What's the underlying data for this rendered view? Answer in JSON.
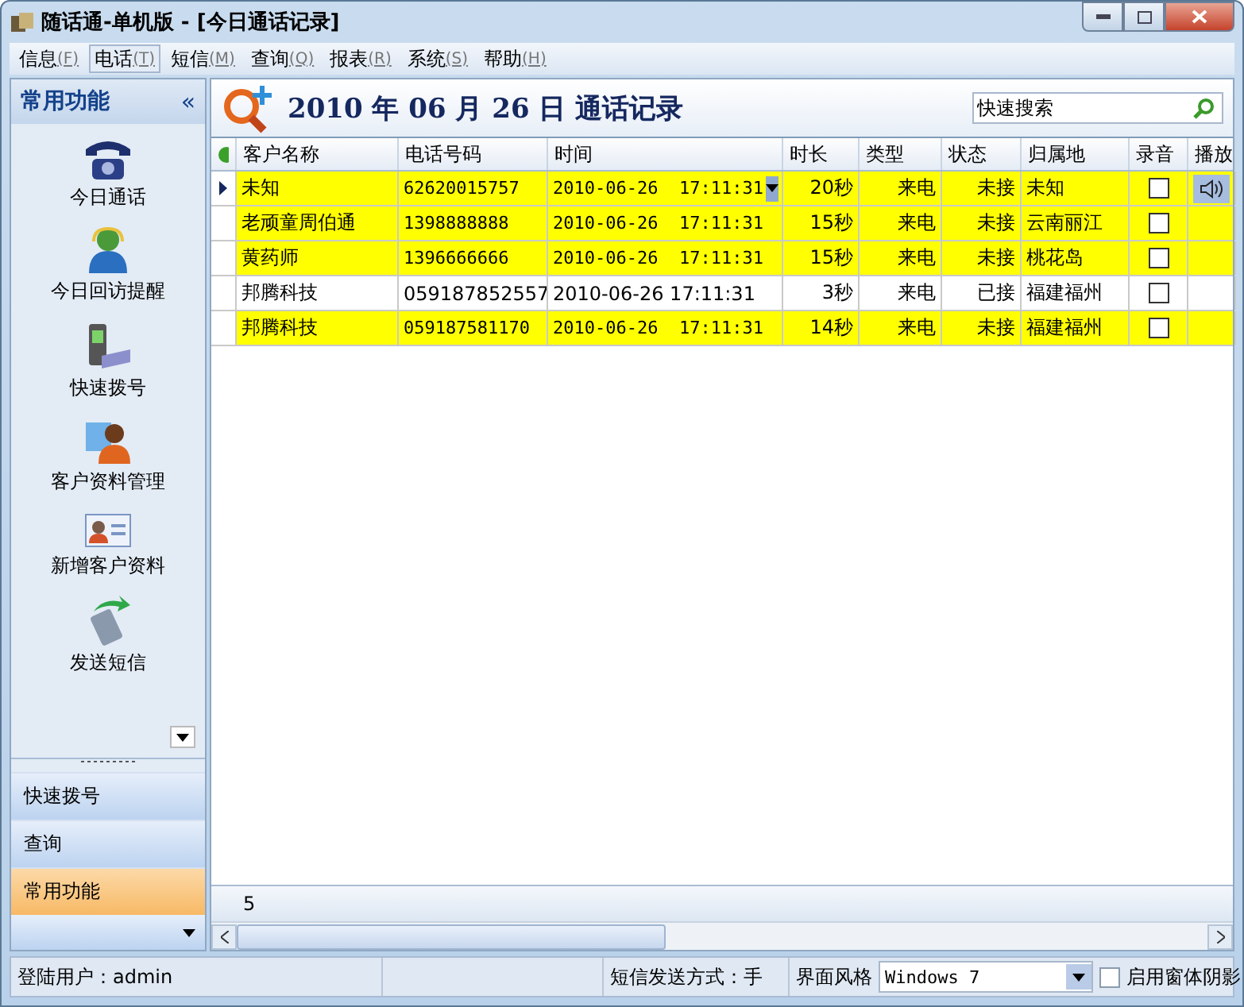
{
  "window": {
    "title": "随话通-单机版 - [今日通话记录]"
  },
  "menu": [
    {
      "label": "信息",
      "hotkey": "(F)",
      "selected": false
    },
    {
      "label": "电话",
      "hotkey": "(T)",
      "selected": true
    },
    {
      "label": "短信",
      "hotkey": "(M)",
      "selected": false
    },
    {
      "label": "查询",
      "hotkey": "(Q)",
      "selected": false
    },
    {
      "label": "报表",
      "hotkey": "(R)",
      "selected": false
    },
    {
      "label": "系统",
      "hotkey": "(S)",
      "selected": false
    },
    {
      "label": "帮助",
      "hotkey": "(H)",
      "selected": false
    }
  ],
  "sidebar": {
    "title": "常用功能",
    "collapse": "«",
    "items": [
      {
        "label": "今日通话"
      },
      {
        "label": "今日回访提醒"
      },
      {
        "label": "快速拨号"
      },
      {
        "label": "客户资料管理"
      },
      {
        "label": "新增客户资料"
      },
      {
        "label": "发送短信"
      }
    ],
    "groups": [
      {
        "label": "快速拨号",
        "selected": false
      },
      {
        "label": "查询",
        "selected": false
      },
      {
        "label": "常用功能",
        "selected": true
      }
    ]
  },
  "heading": "2010 年 06 月 26 日 通话记录",
  "search": {
    "placeholder": "快速搜索"
  },
  "table": {
    "columns": [
      "客户名称",
      "电话号码",
      "时间",
      "时长",
      "类型",
      "状态",
      "归属地",
      "录音",
      "播放"
    ],
    "rows": [
      {
        "name": "未知",
        "phone": "62620015757",
        "time": "2010-06-26  17:11:31",
        "duration": "20秒",
        "type": "来电",
        "status": "未接",
        "location": "未知",
        "recorded": false,
        "highlighted": true,
        "selected": true
      },
      {
        "name": "老顽童周伯通",
        "phone": "1398888888",
        "time": "2010-06-26  17:11:31",
        "duration": "15秒",
        "type": "来电",
        "status": "未接",
        "location": "云南丽江",
        "recorded": false,
        "highlighted": true,
        "selected": false
      },
      {
        "name": "黄药师",
        "phone": "1396666666",
        "time": "2010-06-26  17:11:31",
        "duration": "15秒",
        "type": "来电",
        "status": "未接",
        "location": "桃花岛",
        "recorded": false,
        "highlighted": true,
        "selected": false
      },
      {
        "name": "邦腾科技",
        "phone": "059187852557",
        "time": "2010-06-26 17:11:31",
        "duration": "3秒",
        "type": "来电",
        "status": "已接",
        "location": "福建福州",
        "recorded": false,
        "highlighted": false,
        "selected": false
      },
      {
        "name": "邦腾科技",
        "phone": "059187581170",
        "time": "2010-06-26  17:11:31",
        "duration": "14秒",
        "type": "来电",
        "status": "未接",
        "location": "福建福州",
        "recorded": false,
        "highlighted": true,
        "selected": false
      }
    ],
    "footer_count": "5"
  },
  "status_bar": {
    "user": "登陆用户：admin",
    "sms_mode": "短信发送方式：手",
    "style_label": "界面风格",
    "style_value": "Windows 7",
    "shadow": {
      "label": "启用窗体阴影",
      "checked": false
    }
  }
}
